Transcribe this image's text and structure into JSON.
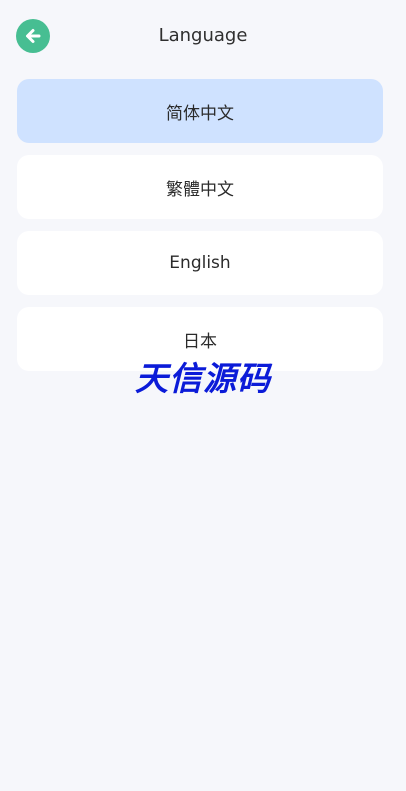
{
  "header": {
    "title": "Language",
    "back_icon": "arrow-left-icon"
  },
  "languages": [
    {
      "label": "简体中文",
      "selected": true
    },
    {
      "label": "繁體中文",
      "selected": false
    },
    {
      "label": "English",
      "selected": false
    },
    {
      "label": "日本",
      "selected": false
    }
  ],
  "watermark": {
    "text": "天信源码"
  },
  "colors": {
    "background": "#f6f7fb",
    "accent": "#47be92",
    "selected_item": "#cfe2ff",
    "item": "#ffffff",
    "watermark": "#0b1bd8"
  }
}
